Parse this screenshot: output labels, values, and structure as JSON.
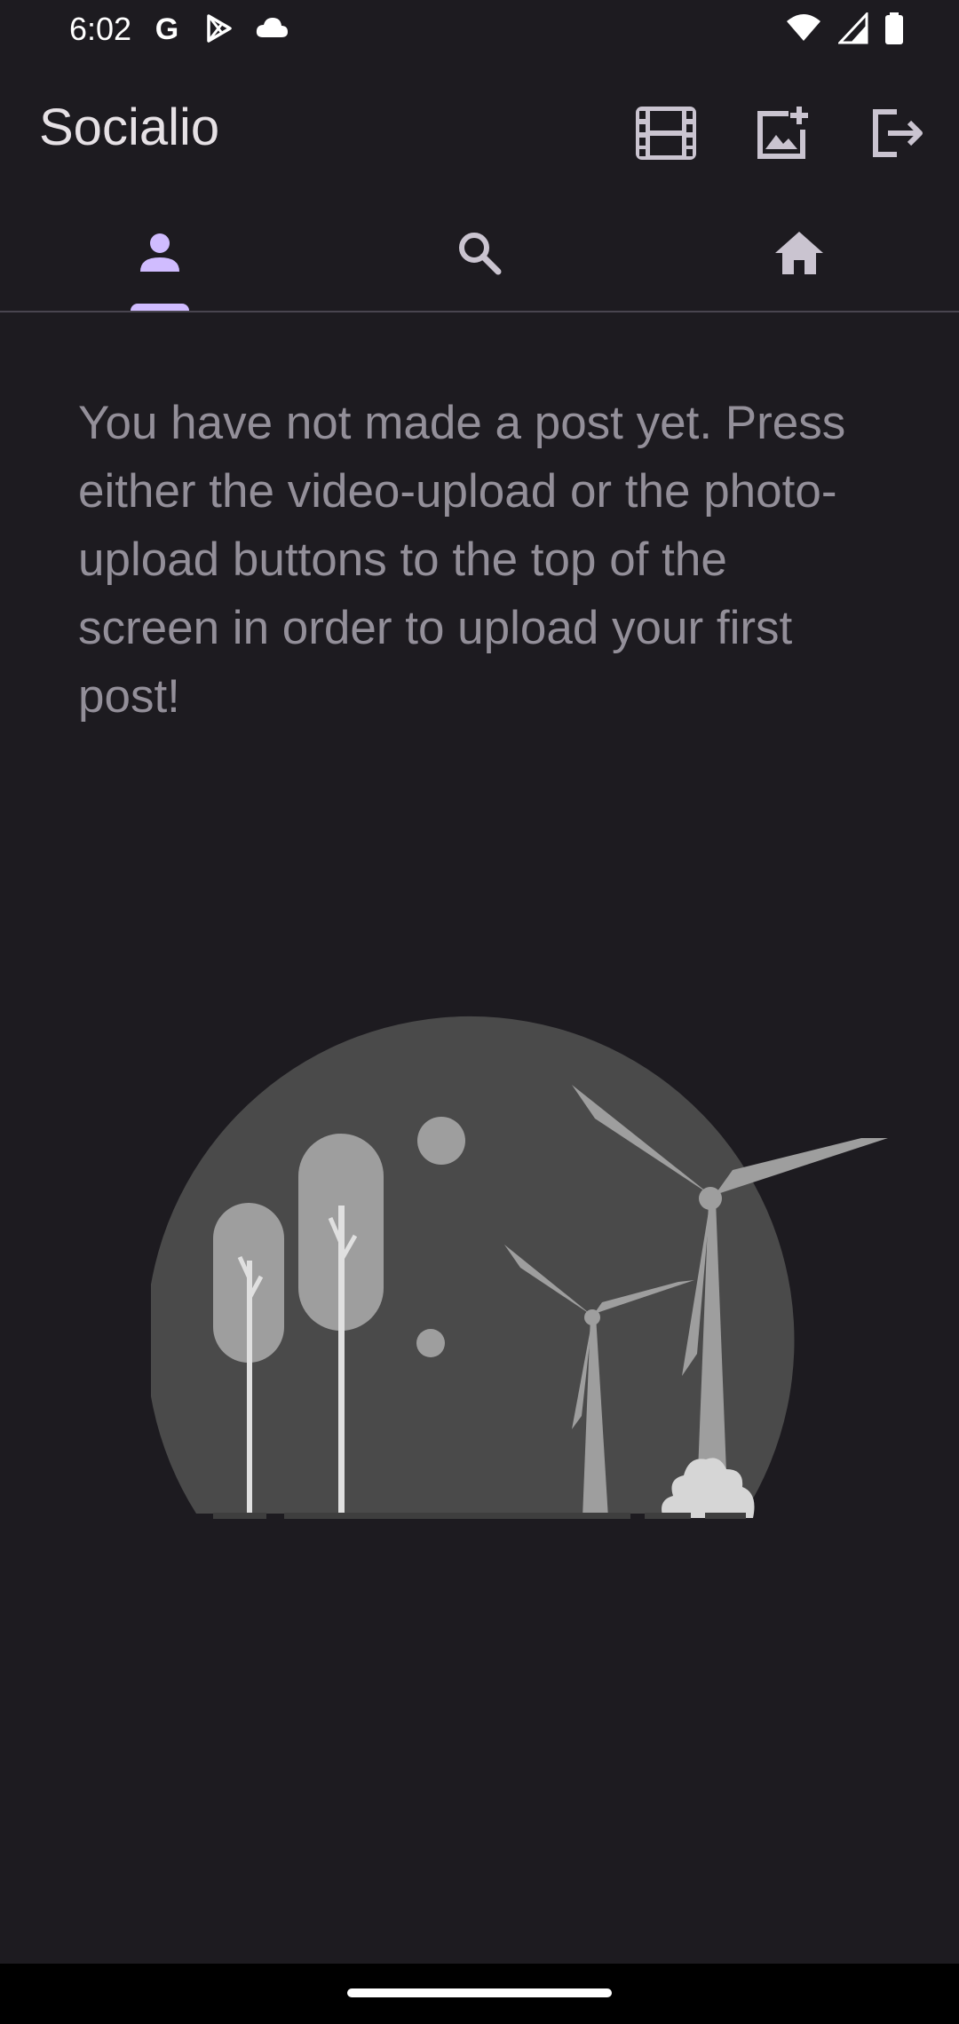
{
  "status_bar": {
    "time": "6:02",
    "left_icons": [
      "google-icon",
      "play-store-icon",
      "cloud-icon"
    ],
    "right_icons": [
      "wifi-icon",
      "signal-icon",
      "battery-icon"
    ]
  },
  "app_bar": {
    "title": "Socialio",
    "actions": [
      "video-upload-icon",
      "photo-upload-icon",
      "logout-icon"
    ]
  },
  "tabs": [
    {
      "icon": "person-icon",
      "selected": true
    },
    {
      "icon": "search-icon",
      "selected": false
    },
    {
      "icon": "home-icon",
      "selected": false
    }
  ],
  "empty_state": {
    "message": "You have not made a post yet. Press either the video-upload or the photo-upload buttons to the top of the screen in order to upload your first post!"
  },
  "colors": {
    "background": "#1d1b20",
    "accent": "#d0bcff",
    "muted_text": "#938f99"
  }
}
